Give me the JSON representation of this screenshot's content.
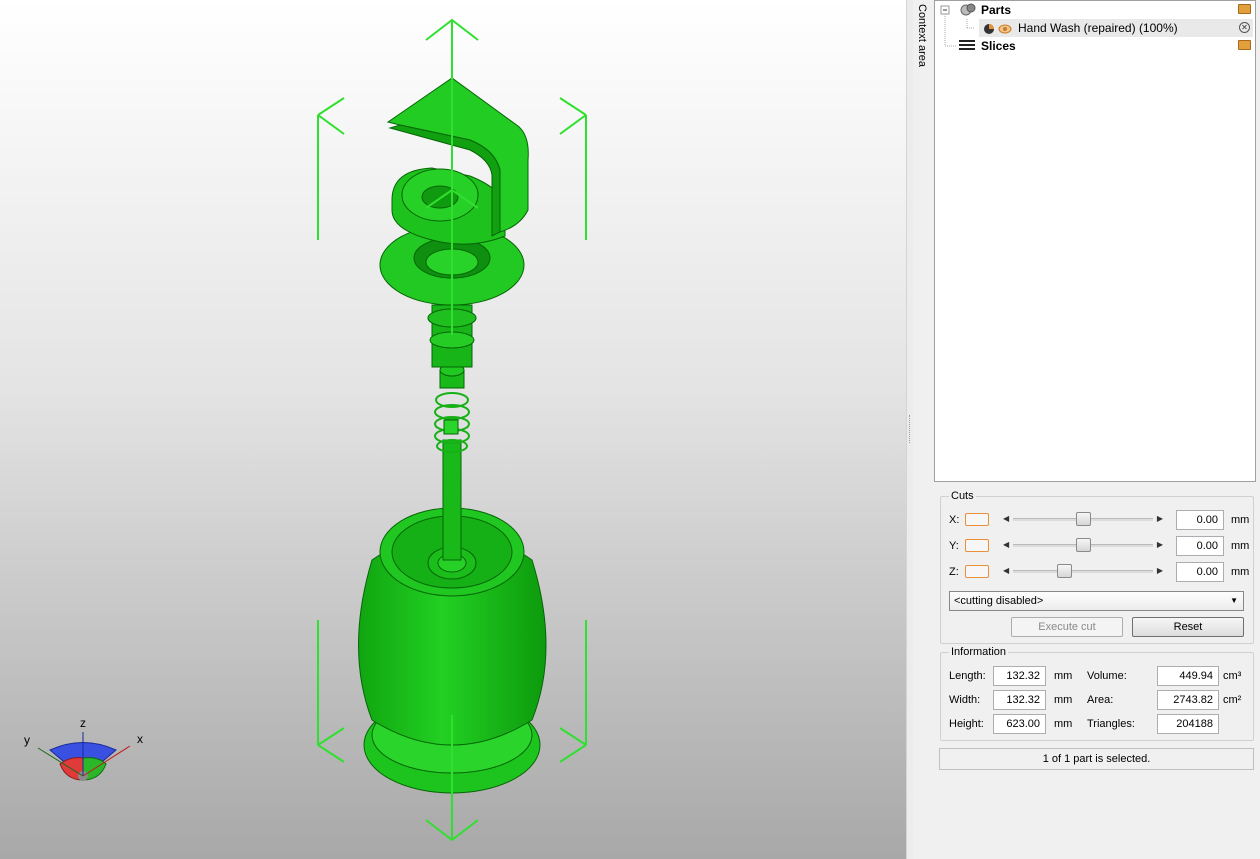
{
  "colors": {
    "model": "#18c618",
    "model_dark": "#0a7d0a",
    "bounds": "#2fe02f",
    "accent": "#e8903a"
  },
  "context_tab": {
    "label": "Context area"
  },
  "tree": {
    "parts_label": "Parts",
    "part_item_label": "Hand Wash (repaired) (100%)",
    "slices_label": "Slices"
  },
  "axis_widget": {
    "x": "x",
    "y": "y",
    "z": "z"
  },
  "cuts": {
    "title": "Cuts",
    "rows": [
      {
        "axis": "X:",
        "value": "0.00",
        "unit": "mm",
        "level": 0.5
      },
      {
        "axis": "Y:",
        "value": "0.00",
        "unit": "mm",
        "level": 0.5
      },
      {
        "axis": "Z:",
        "value": "0.00",
        "unit": "mm",
        "level": 0.35
      }
    ],
    "mode_select": "<cutting disabled>",
    "execute_label": "Execute cut",
    "reset_label": "Reset"
  },
  "information": {
    "title": "Information",
    "length_label": "Length:",
    "length_value": "132.32",
    "length_unit": "mm",
    "width_label": "Width:",
    "width_value": "132.32",
    "width_unit": "mm",
    "height_label": "Height:",
    "height_value": "623.00",
    "height_unit": "mm",
    "volume_label": "Volume:",
    "volume_value": "449.94",
    "volume_unit": "cm³",
    "area_label": "Area:",
    "area_value": "2743.82",
    "area_unit": "cm²",
    "triangles_label": "Triangles:",
    "triangles_value": "204188"
  },
  "status": {
    "text": "1 of 1 part is selected."
  }
}
